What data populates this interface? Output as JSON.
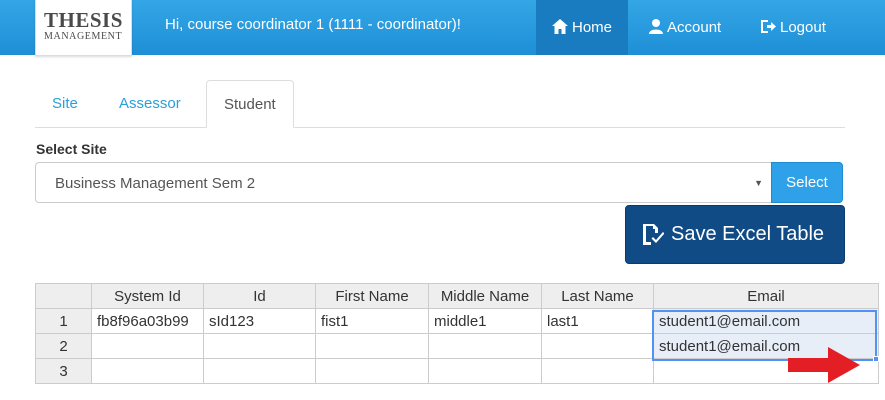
{
  "navbar": {
    "logo_line1": "THESIS",
    "logo_line2": "MANAGEMENT",
    "greeting": "Hi, course coordinator 1 (1111 - coordinator)!",
    "links": [
      {
        "label": "Home",
        "icon": "home-icon"
      },
      {
        "label": "Account",
        "icon": "user-icon"
      },
      {
        "label": "Logout",
        "icon": "logout-icon"
      }
    ]
  },
  "tabs": [
    {
      "label": "Site"
    },
    {
      "label": "Assessor"
    },
    {
      "label": "Student"
    }
  ],
  "select_site": {
    "label": "Select Site",
    "value": "Business Management Sem 2",
    "button": "Select"
  },
  "save_button": "Save Excel Table",
  "sheet": {
    "columns": [
      "System Id",
      "Id",
      "First Name",
      "Middle Name",
      "Last Name",
      "Email"
    ],
    "row_numbers": [
      "1",
      "2",
      "3"
    ],
    "rows": [
      [
        "fb8f96a03b99",
        "sId123",
        "fist1",
        "middle1",
        "last1",
        "student1@email.com"
      ],
      [
        "",
        "",
        "",
        "",
        "",
        "student1@email.com"
      ],
      [
        "",
        "",
        "",
        "",
        "",
        ""
      ]
    ]
  },
  "colors": {
    "navbar": "#1e8fd6",
    "accent": "#2a9fd8",
    "save_button": "#114b86",
    "selection": "#5292f7",
    "arrow": "#e31e24"
  }
}
